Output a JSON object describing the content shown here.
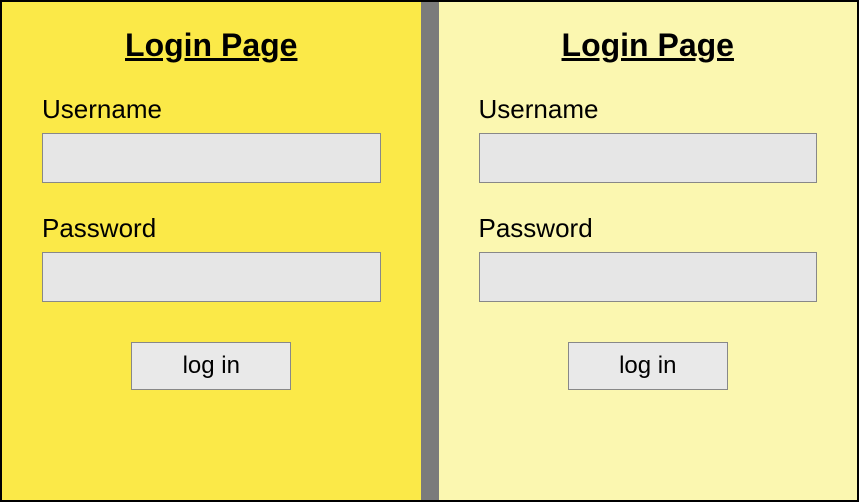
{
  "left": {
    "title": "Login Page",
    "username_label": "Username",
    "username_value": "",
    "password_label": "Password",
    "password_value": "",
    "login_button_label": "log in",
    "background_color": "#fbe948"
  },
  "right": {
    "title": "Login Page",
    "username_label": "Username",
    "username_value": "",
    "password_label": "Password",
    "password_value": "",
    "login_button_label": "log in",
    "background_color": "#fbf7b0"
  },
  "divider_color": "#7b7b7b"
}
